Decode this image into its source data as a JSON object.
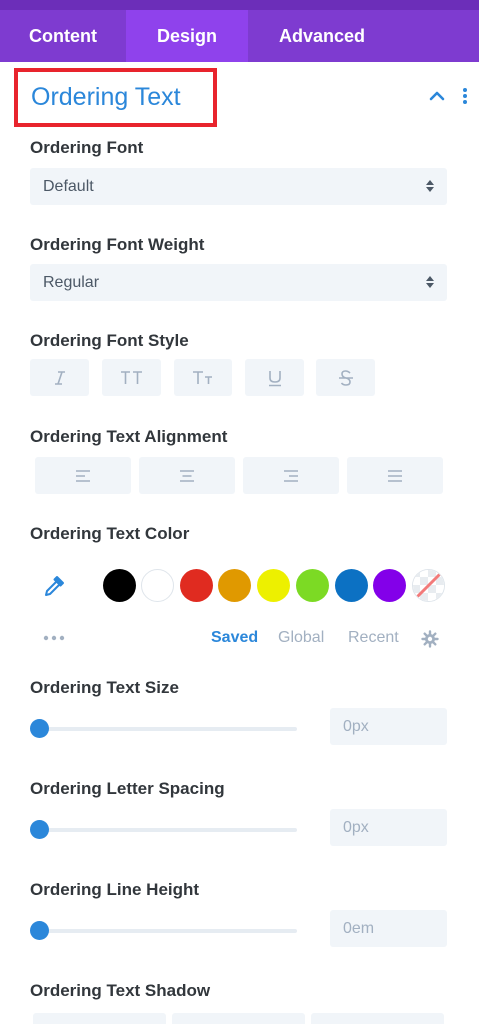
{
  "tabs": [
    {
      "label": "Content",
      "active": false
    },
    {
      "label": "Design",
      "active": true
    },
    {
      "label": "Advanced",
      "active": false
    }
  ],
  "section": {
    "title": "Ordering Text",
    "collapse_icon": "chevron-up-icon",
    "menu_icon": "more-vertical-icon"
  },
  "font": {
    "label": "Ordering Font",
    "value": "Default"
  },
  "font_weight": {
    "label": "Ordering Font Weight",
    "value": "Regular"
  },
  "font_style": {
    "label": "Ordering Font Style",
    "buttons": [
      "italic-icon",
      "uppercase-icon",
      "capitalize-icon",
      "underline-icon",
      "strikethrough-icon"
    ]
  },
  "alignment": {
    "label": "Ordering Text Alignment",
    "buttons": [
      "align-left-icon",
      "align-center-icon",
      "align-right-icon",
      "align-justify-icon"
    ]
  },
  "text_color": {
    "label": "Ordering Text Color",
    "eyedropper_icon": "eyedropper-icon",
    "swatches": [
      "#000000",
      "#ffffff",
      "#e02b20",
      "#e09900",
      "#edf000",
      "#7cda24",
      "#0c71c3",
      "#8300e9"
    ],
    "none_swatch_icon": "no-color-icon",
    "more_icon": "more-horizontal-icon",
    "palette_tabs": [
      "Saved",
      "Global",
      "Recent"
    ],
    "active_palette": "Saved",
    "settings_icon": "gear-icon",
    "accent": "#2b87da"
  },
  "text_size": {
    "label": "Ordering Text Size",
    "value": "0px",
    "level": 0
  },
  "letter_spacing": {
    "label": "Ordering Letter Spacing",
    "value": "0px",
    "level": 0
  },
  "line_height": {
    "label": "Ordering Line Height",
    "value": "0em",
    "level": 0
  },
  "text_shadow": {
    "label": "Ordering Text Shadow"
  }
}
